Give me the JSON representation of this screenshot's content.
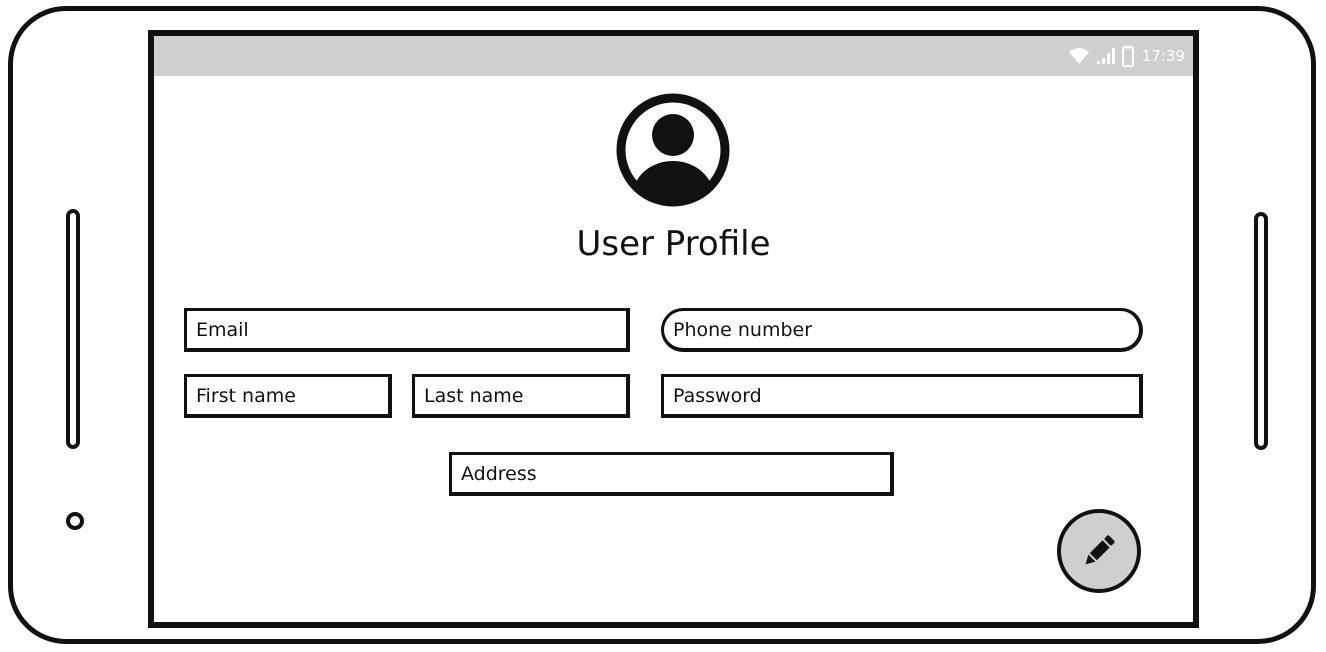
{
  "status_bar": {
    "time": "17:39",
    "icons": [
      "wifi-icon",
      "signal-icon",
      "battery-icon"
    ]
  },
  "profile": {
    "title": "User Profile",
    "avatar_icon": "user-avatar-icon"
  },
  "form": {
    "email_placeholder": "Email",
    "phone_placeholder": "Phone number",
    "first_name_placeholder": "First name",
    "last_name_placeholder": "Last name",
    "password_placeholder": "Password",
    "address_placeholder": "Address"
  },
  "fab": {
    "icon": "pencil-icon"
  },
  "colors": {
    "outline": "#111111",
    "status_bar": "#cfcfcf",
    "fab_fill": "#cfcfcf",
    "background": "#ffffff"
  }
}
